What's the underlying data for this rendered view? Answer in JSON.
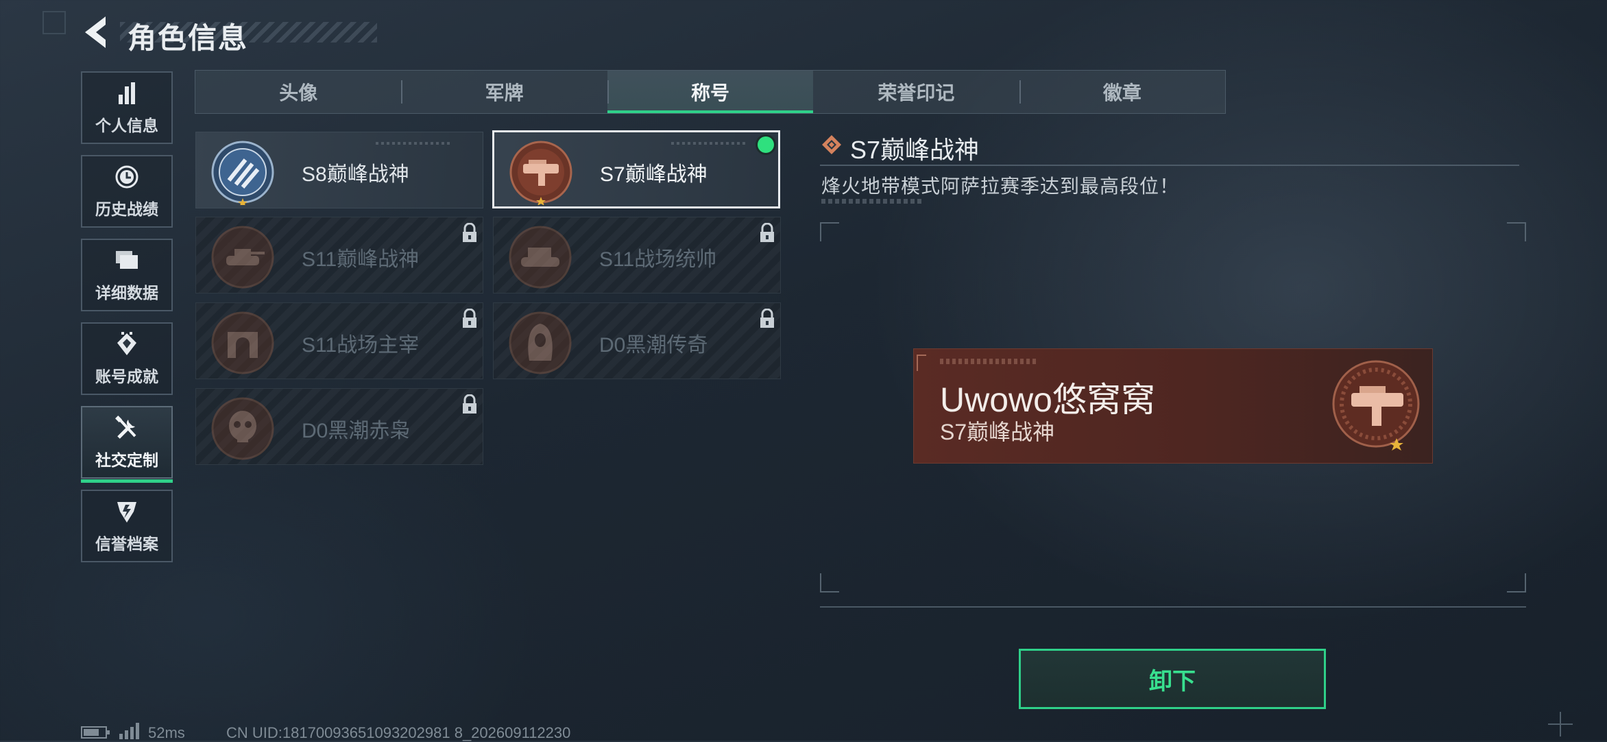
{
  "header": {
    "title": "角色信息"
  },
  "sidebar": {
    "items": [
      {
        "label": "个人信息",
        "icon": "bar-chart-icon"
      },
      {
        "label": "历史战绩",
        "icon": "history-clock-icon"
      },
      {
        "label": "详细数据",
        "icon": "folders-icon"
      },
      {
        "label": "账号成就",
        "icon": "achievement-icon"
      },
      {
        "label": "社交定制",
        "icon": "tools-icon",
        "active": true
      },
      {
        "label": "信誉档案",
        "icon": "credit-shield-icon"
      }
    ]
  },
  "tabs": [
    {
      "label": "头像"
    },
    {
      "label": "军牌"
    },
    {
      "label": "称号",
      "active": true
    },
    {
      "label": "荣誉印记"
    },
    {
      "label": "徽章"
    }
  ],
  "titles": [
    {
      "name": "S8巅峰战神",
      "locked": false,
      "selected": false,
      "emblem": "s8-blue-emblem-icon"
    },
    {
      "name": "S7巅峰战神",
      "locked": false,
      "selected": true,
      "equipped": true,
      "emblem": "s7-gun-emblem-icon"
    },
    {
      "name": "S11巅峰战神",
      "locked": true,
      "emblem": "tank-emblem-icon"
    },
    {
      "name": "S11战场统帅",
      "locked": true,
      "emblem": "armored-vehicle-emblem-icon"
    },
    {
      "name": "S11战场主宰",
      "locked": true,
      "emblem": "arch-emblem-icon"
    },
    {
      "name": "D0黑潮传奇",
      "locked": true,
      "emblem": "hooded-figure-emblem-icon"
    },
    {
      "name": "D0黑潮赤枭",
      "locked": true,
      "emblem": "skull-emblem-icon"
    }
  ],
  "detail": {
    "title": "S7巅峰战神",
    "description": "烽火地带模式阿萨拉赛季达到最高段位！",
    "preview": {
      "player_name": "Uwowo悠窝窝",
      "title": "S7巅峰战神"
    },
    "unequip_label": "卸下"
  },
  "status": {
    "ping": "52ms",
    "uid": "CN UID:18170093651093202981 8_202609112230"
  },
  "colors": {
    "accent": "#2fd089",
    "equipped_dot": "#2fe07e",
    "banner_bg": "#5a2b24"
  }
}
